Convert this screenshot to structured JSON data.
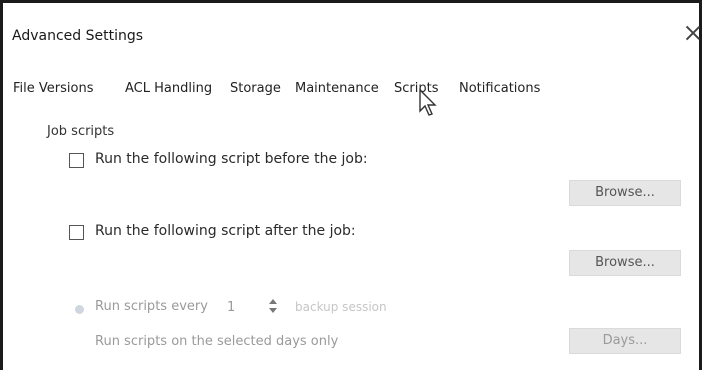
{
  "dialog": {
    "title": "Advanced Settings"
  },
  "tabs": [
    "File Versions",
    "ACL Handling",
    "Storage",
    "Maintenance",
    "Scripts",
    "Notifications"
  ],
  "active_tab": "Scripts",
  "section": {
    "job_scripts": "Job scripts"
  },
  "before_job": {
    "label": "Run the following script before the job:",
    "checked": false,
    "browse_label": "Browse..."
  },
  "after_job": {
    "label": "Run the following script after the job:",
    "checked": false,
    "browse_label": "Browse..."
  },
  "run_every": {
    "label": "Run scripts every",
    "value": "1",
    "suffix": "backup session"
  },
  "days_only": {
    "label": "Run scripts on the selected days only",
    "button": "Days..."
  },
  "colors": {
    "accent": "#1b1b1b",
    "disabled": "#9a9a9a"
  }
}
